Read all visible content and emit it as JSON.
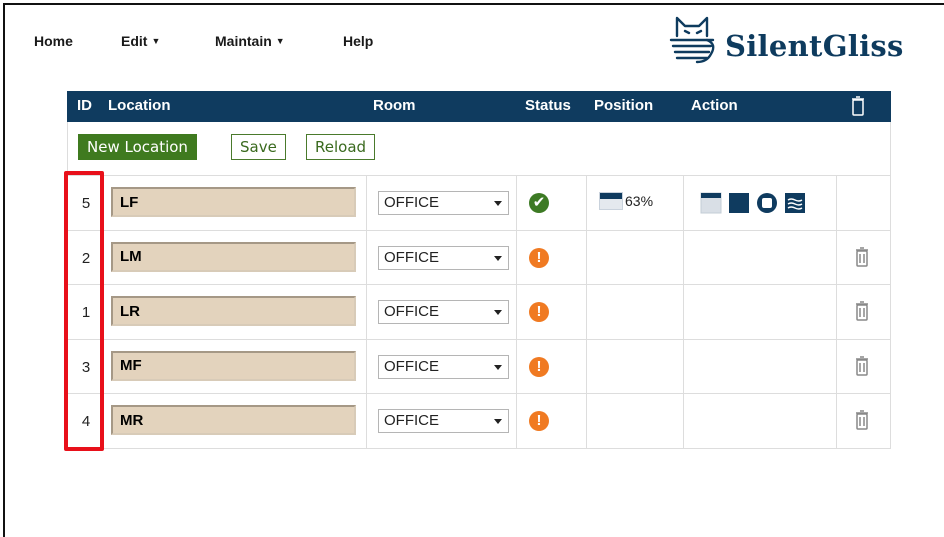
{
  "nav": {
    "home": "Home",
    "edit": "Edit",
    "maintain": "Maintain",
    "help": "Help"
  },
  "logo": {
    "text": "SilentGliss"
  },
  "table": {
    "headers": {
      "id": "ID",
      "location": "Location",
      "room": "Room",
      "status": "Status",
      "position": "Position",
      "action": "Action"
    },
    "toolbar": {
      "new_location": "New Location",
      "save": "Save",
      "reload": "Reload"
    },
    "rows": [
      {
        "id": "5",
        "location": "LF",
        "room": "OFFICE",
        "status": "ok",
        "position": "63%"
      },
      {
        "id": "2",
        "location": "LM",
        "room": "OFFICE",
        "status": "warning",
        "position": ""
      },
      {
        "id": "1",
        "location": "LR",
        "room": "OFFICE",
        "status": "warning",
        "position": ""
      },
      {
        "id": "3",
        "location": "MF",
        "room": "OFFICE",
        "status": "warning",
        "position": ""
      },
      {
        "id": "4",
        "location": "MR",
        "room": "OFFICE",
        "status": "warning",
        "position": ""
      }
    ]
  },
  "colors": {
    "header_bg": "#0f3b5f",
    "button_green": "#3f7a1f",
    "status_ok": "#3d7a24",
    "status_warning": "#f07a22",
    "input_bg": "#e3d3bd",
    "highlight": "#e8101a"
  },
  "icons": {
    "status_ok": "checkmark-circle-icon",
    "status_warning": "exclamation-circle-icon",
    "delete": "trash-icon",
    "position": "blind-shade-icon",
    "actions": [
      "blind-up-icon",
      "blind-down-icon",
      "stop-icon",
      "wind-icon"
    ]
  }
}
